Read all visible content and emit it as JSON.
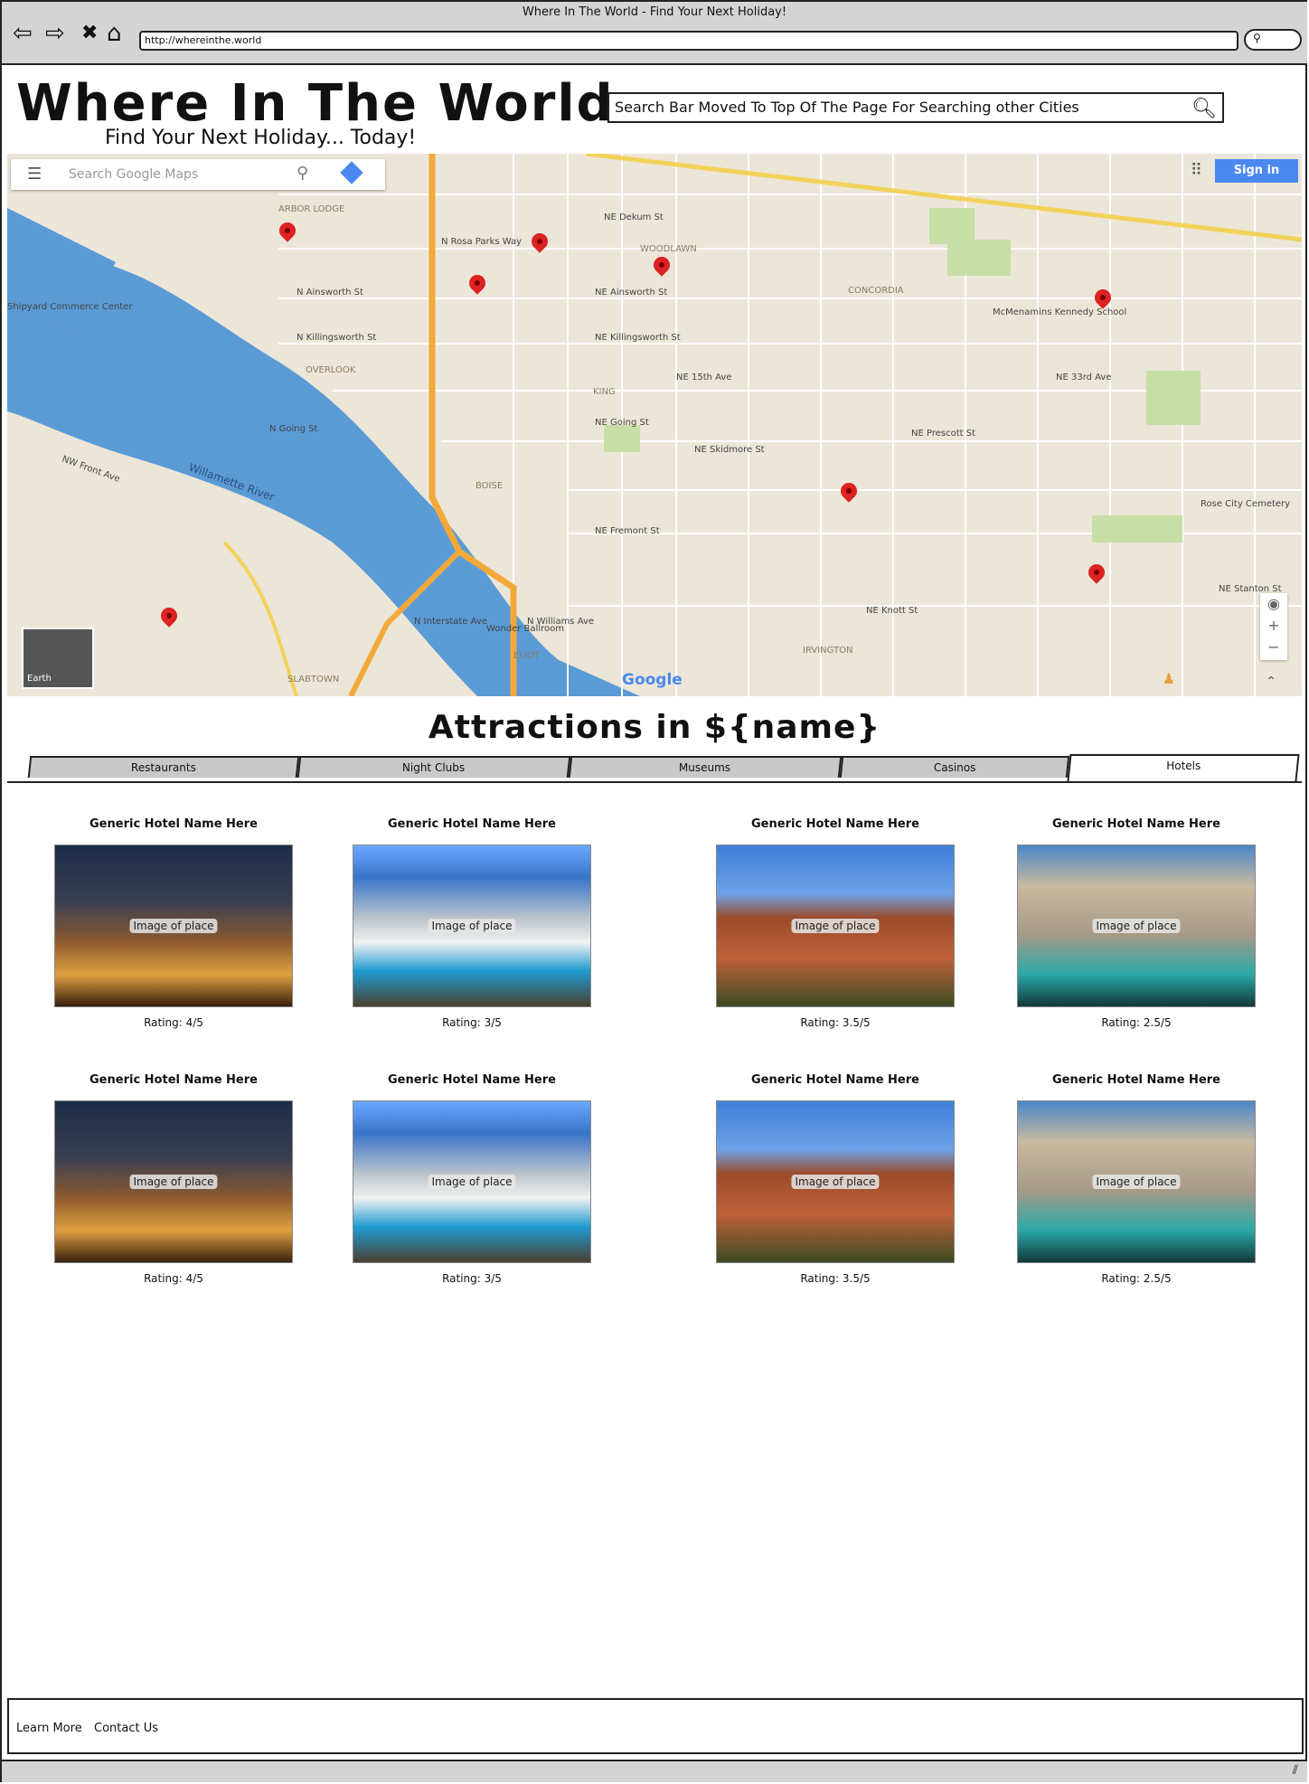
{
  "browser": {
    "window_title": "Where In The World - Find Your Next Holiday!",
    "url": "http://whereinthe.world",
    "back_glyph": "⇦",
    "forward_glyph": "⇨",
    "stop_glyph": "✖",
    "home_glyph": "⌂",
    "search_glyph": "⚲"
  },
  "header": {
    "title": "Where In The World",
    "subtitle": "Find Your Next Holiday... Today!",
    "search_text": "Search Bar Moved To Top Of The Page For Searching other Cities"
  },
  "map": {
    "search_placeholder": "Search Google Maps",
    "sign_in": "Sign in",
    "earth_label": "Earth",
    "google_logo": "Google",
    "river_label": "Willamette River",
    "street_labels": [
      "N Rosa Parks Way",
      "N Ainsworth St",
      "N Killingsworth St",
      "N Going St",
      "NE Dekum St",
      "NE Ainsworth St",
      "NE Killingsworth St",
      "NE Going St",
      "NE Skidmore St",
      "NE Fremont St",
      "NE Knott St",
      "NE Stanton St",
      "NE Prescott St",
      "NW Front Ave",
      "N Interstate Ave",
      "N Williams Ave",
      "NE 15th Ave",
      "NE 33rd Ave",
      "WOODLAWN",
      "CONCORDIA",
      "KING",
      "BOISE",
      "OVERLOOK",
      "IRVINGTON",
      "ELIOT",
      "ARBOR LODGE",
      "SLABTOWN",
      "Rose City Cemetery",
      "Wonder Ballroom",
      "McMenamins Kennedy School",
      "Shipyard Commerce Center"
    ],
    "zoom_in": "+",
    "zoom_out": "−",
    "marker_count": 8
  },
  "attractions": {
    "heading": "Attractions in ${name}",
    "tabs": [
      "Restaurants",
      "Night Clubs",
      "Museums",
      "Casinos",
      "Hotels"
    ],
    "active_tab": "Hotels",
    "image_label": "Image of place",
    "hotels": [
      {
        "name": "Generic Hotel Name Here",
        "rating": "Rating: 4/5"
      },
      {
        "name": "Generic Hotel Name Here",
        "rating": "Rating: 3/5"
      },
      {
        "name": "Generic Hotel Name Here",
        "rating": "Rating: 3.5/5"
      },
      {
        "name": "Generic Hotel Name Here",
        "rating": "Rating: 2.5/5"
      },
      {
        "name": "Generic Hotel Name Here",
        "rating": "Rating: 4/5"
      },
      {
        "name": "Generic Hotel Name Here",
        "rating": "Rating: 3/5"
      },
      {
        "name": "Generic Hotel Name Here",
        "rating": "Rating: 3.5/5"
      },
      {
        "name": "Generic Hotel Name Here",
        "rating": "Rating: 2.5/5"
      }
    ]
  },
  "footer": {
    "learn_more": "Learn More",
    "contact_us": "Contact Us"
  },
  "colors": {
    "accent": "#4a88f0",
    "marker": "#dd2222",
    "map_background": "#ece6d8",
    "water": "#5b9bd5",
    "highway": "#f3a93a"
  }
}
